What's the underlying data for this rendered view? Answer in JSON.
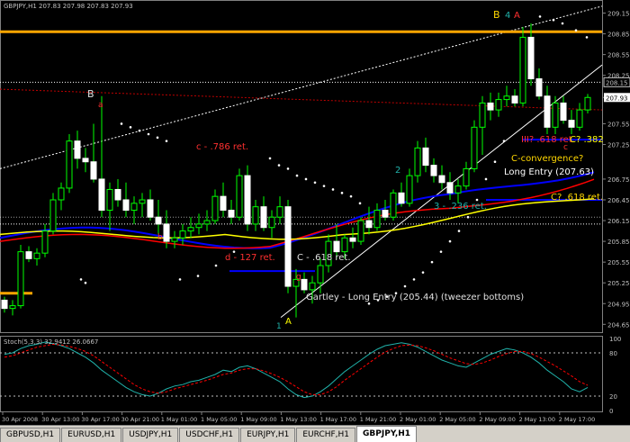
{
  "window": {
    "header": "GBPJPY,H1  207.83 207.98 207.83 207.93",
    "stoch_label": "Stoch(5,3,3) 32.9412 26.0667"
  },
  "colors": {
    "background": "#000000",
    "bull": "#00ff00",
    "bear": "#ffffff",
    "orange": "#ffa500",
    "blue": "#0000ff",
    "red": "#ff0000",
    "yellow": "#ffff00",
    "stoch_main": "#20b2aa",
    "stoch_signal": "#ff0000"
  },
  "price_axis": {
    "ticks": [
      "209.15",
      "208.85",
      "208.55",
      "208.25",
      "207.93",
      "207.55",
      "207.25",
      "206.75",
      "206.45",
      "206.15",
      "205.85",
      "205.55",
      "205.25",
      "204.95",
      "204.65"
    ],
    "current_price": "207.93",
    "mid_label": "208.15",
    "ylim": [
      204.55,
      209.3
    ]
  },
  "stoch_axis": {
    "ticks": [
      "100",
      "80",
      "20",
      "0"
    ],
    "levels": [
      80,
      20
    ]
  },
  "time_axis": {
    "labels": [
      "30 Apr 2008",
      "30 Apr 13:00",
      "30 Apr 17:00",
      "30 Apr 21:00",
      "1 May 01:00",
      "1 May 05:00",
      "1 May 09:00",
      "1 May 13:00",
      "1 May 17:00",
      "1 May 21:00",
      "2 May 01:00",
      "2 May 05:00",
      "2 May 09:00",
      "2 May 13:00",
      "2 May 17:00"
    ]
  },
  "annotations": {
    "B_left": "B",
    "a_left": "a",
    "c_786": "c - .786 ret.",
    "b_label": "b",
    "d_127": "d - 127 ret.",
    "c_618": "C - .618 ret.",
    "gartley": "Gartley - Long Entry (205.44) (tweezer bottoms)",
    "one": "1",
    "A_label": "A",
    "g_label": "g",
    "two": "2",
    "three": "3 - .236 ret.",
    "B_top": "B",
    "four": "4",
    "A_top": "A",
    "III_618": "III? .618 ret.",
    "C_382": "C? .382",
    "C_conv": "C-convergence?",
    "long_entry": "Long Entry (207.63)",
    "C_618_right": "C? .618 ret.",
    "small_c": "c"
  },
  "tabs": [
    "GBPUSD,H1",
    "EURUSD,H1",
    "USDJPY,H1",
    "USDCHF,H1",
    "EURJPY,H1",
    "EURCHF,H1",
    "GBPJPY,H1"
  ],
  "active_tab": "GBPJPY,H1",
  "chart_data": {
    "type": "candlestick",
    "candles": [
      {
        "o": 205.0,
        "h": 205.05,
        "l": 204.82,
        "c": 204.88
      },
      {
        "o": 204.88,
        "h": 205.0,
        "l": 204.78,
        "c": 204.92
      },
      {
        "o": 204.92,
        "h": 205.8,
        "l": 204.88,
        "c": 205.7
      },
      {
        "o": 205.7,
        "h": 205.78,
        "l": 205.55,
        "c": 205.6
      },
      {
        "o": 205.6,
        "h": 205.75,
        "l": 205.5,
        "c": 205.68
      },
      {
        "o": 205.68,
        "h": 206.1,
        "l": 205.62,
        "c": 206.0
      },
      {
        "o": 206.0,
        "h": 206.55,
        "l": 205.95,
        "c": 206.45
      },
      {
        "o": 206.45,
        "h": 206.7,
        "l": 206.3,
        "c": 206.62
      },
      {
        "o": 206.62,
        "h": 207.4,
        "l": 206.55,
        "c": 207.3
      },
      {
        "o": 207.3,
        "h": 207.45,
        "l": 206.9,
        "c": 207.05
      },
      {
        "o": 207.05,
        "h": 207.2,
        "l": 206.85,
        "c": 207.0
      },
      {
        "o": 207.0,
        "h": 207.55,
        "l": 206.7,
        "c": 206.75
      },
      {
        "o": 206.75,
        "h": 207.95,
        "l": 206.2,
        "c": 206.3
      },
      {
        "o": 206.3,
        "h": 206.7,
        "l": 206.0,
        "c": 206.6
      },
      {
        "o": 206.6,
        "h": 206.75,
        "l": 206.35,
        "c": 206.45
      },
      {
        "o": 206.45,
        "h": 206.7,
        "l": 206.2,
        "c": 206.3
      },
      {
        "o": 206.3,
        "h": 206.5,
        "l": 206.1,
        "c": 206.4
      },
      {
        "o": 206.4,
        "h": 206.55,
        "l": 206.2,
        "c": 206.45
      },
      {
        "o": 206.45,
        "h": 206.6,
        "l": 206.15,
        "c": 206.2
      },
      {
        "o": 206.2,
        "h": 206.45,
        "l": 205.95,
        "c": 206.1
      },
      {
        "o": 206.1,
        "h": 206.3,
        "l": 205.75,
        "c": 205.85
      },
      {
        "o": 205.85,
        "h": 206.0,
        "l": 205.75,
        "c": 205.9
      },
      {
        "o": 205.9,
        "h": 206.1,
        "l": 205.8,
        "c": 206.0
      },
      {
        "o": 206.0,
        "h": 206.2,
        "l": 205.9,
        "c": 206.05
      },
      {
        "o": 206.05,
        "h": 206.25,
        "l": 205.95,
        "c": 206.1
      },
      {
        "o": 206.1,
        "h": 206.3,
        "l": 206.0,
        "c": 206.15
      },
      {
        "o": 206.15,
        "h": 206.6,
        "l": 206.1,
        "c": 206.5
      },
      {
        "o": 206.5,
        "h": 206.7,
        "l": 206.2,
        "c": 206.3
      },
      {
        "o": 206.3,
        "h": 206.45,
        "l": 206.1,
        "c": 206.2
      },
      {
        "o": 206.2,
        "h": 206.9,
        "l": 206.15,
        "c": 206.8
      },
      {
        "o": 206.8,
        "h": 206.95,
        "l": 206.0,
        "c": 206.1
      },
      {
        "o": 206.1,
        "h": 206.45,
        "l": 206.0,
        "c": 206.35
      },
      {
        "o": 206.35,
        "h": 206.5,
        "l": 206.0,
        "c": 206.05
      },
      {
        "o": 206.05,
        "h": 206.3,
        "l": 205.9,
        "c": 206.2
      },
      {
        "o": 206.2,
        "h": 206.5,
        "l": 206.1,
        "c": 206.35
      },
      {
        "o": 206.35,
        "h": 206.45,
        "l": 205.1,
        "c": 205.2
      },
      {
        "o": 205.2,
        "h": 205.45,
        "l": 204.75,
        "c": 205.3
      },
      {
        "o": 205.3,
        "h": 205.4,
        "l": 205.1,
        "c": 205.15
      },
      {
        "o": 205.15,
        "h": 205.35,
        "l": 204.95,
        "c": 205.25
      },
      {
        "o": 205.25,
        "h": 205.6,
        "l": 205.1,
        "c": 205.5
      },
      {
        "o": 205.5,
        "h": 205.95,
        "l": 205.4,
        "c": 205.85
      },
      {
        "o": 205.85,
        "h": 206.1,
        "l": 205.6,
        "c": 205.7
      },
      {
        "o": 205.7,
        "h": 205.95,
        "l": 205.6,
        "c": 205.9
      },
      {
        "o": 205.9,
        "h": 206.05,
        "l": 205.75,
        "c": 205.85
      },
      {
        "o": 205.85,
        "h": 206.2,
        "l": 205.8,
        "c": 206.15
      },
      {
        "o": 206.15,
        "h": 206.35,
        "l": 205.95,
        "c": 206.05
      },
      {
        "o": 206.05,
        "h": 206.4,
        "l": 206.0,
        "c": 206.3
      },
      {
        "o": 206.3,
        "h": 206.45,
        "l": 206.15,
        "c": 206.2
      },
      {
        "o": 206.2,
        "h": 206.6,
        "l": 206.15,
        "c": 206.55
      },
      {
        "o": 206.55,
        "h": 206.7,
        "l": 206.35,
        "c": 206.4
      },
      {
        "o": 206.4,
        "h": 206.9,
        "l": 206.35,
        "c": 206.8
      },
      {
        "o": 206.8,
        "h": 207.3,
        "l": 206.7,
        "c": 207.2
      },
      {
        "o": 207.2,
        "h": 207.35,
        "l": 206.85,
        "c": 206.95
      },
      {
        "o": 206.95,
        "h": 207.05,
        "l": 206.7,
        "c": 206.8
      },
      {
        "o": 206.8,
        "h": 206.95,
        "l": 206.6,
        "c": 206.7
      },
      {
        "o": 206.7,
        "h": 206.85,
        "l": 206.45,
        "c": 206.55
      },
      {
        "o": 206.55,
        "h": 206.75,
        "l": 206.4,
        "c": 206.65
      },
      {
        "o": 206.65,
        "h": 207.0,
        "l": 206.6,
        "c": 206.9
      },
      {
        "o": 206.9,
        "h": 207.6,
        "l": 206.85,
        "c": 207.5
      },
      {
        "o": 207.5,
        "h": 207.95,
        "l": 207.1,
        "c": 207.85
      },
      {
        "o": 207.85,
        "h": 208.0,
        "l": 207.6,
        "c": 207.75
      },
      {
        "o": 207.75,
        "h": 208.0,
        "l": 207.65,
        "c": 207.9
      },
      {
        "o": 207.9,
        "h": 208.1,
        "l": 207.8,
        "c": 207.95
      },
      {
        "o": 207.95,
        "h": 208.05,
        "l": 207.8,
        "c": 207.85
      },
      {
        "o": 207.85,
        "h": 208.95,
        "l": 207.8,
        "c": 208.8
      },
      {
        "o": 208.8,
        "h": 209.0,
        "l": 208.1,
        "c": 208.2
      },
      {
        "o": 208.2,
        "h": 208.35,
        "l": 207.9,
        "c": 207.95
      },
      {
        "o": 207.95,
        "h": 208.1,
        "l": 207.4,
        "c": 207.5
      },
      {
        "o": 207.5,
        "h": 207.95,
        "l": 207.4,
        "c": 207.85
      },
      {
        "o": 207.85,
        "h": 207.95,
        "l": 207.55,
        "c": 207.6
      },
      {
        "o": 207.6,
        "h": 207.75,
        "l": 207.4,
        "c": 207.5
      },
      {
        "o": 207.5,
        "h": 207.85,
        "l": 207.45,
        "c": 207.75
      },
      {
        "o": 207.75,
        "h": 207.98,
        "l": 207.7,
        "c": 207.93
      }
    ],
    "stochastic": {
      "main": [
        78,
        80,
        86,
        90,
        92,
        95,
        93,
        90,
        86,
        80,
        74,
        66,
        56,
        48,
        40,
        32,
        26,
        22,
        20,
        24,
        30,
        34,
        36,
        40,
        42,
        46,
        50,
        56,
        54,
        60,
        62,
        58,
        52,
        46,
        40,
        30,
        22,
        18,
        20,
        26,
        34,
        44,
        54,
        62,
        70,
        78,
        85,
        90,
        92,
        94,
        92,
        88,
        82,
        76,
        70,
        66,
        62,
        60,
        66,
        72,
        78,
        82,
        86,
        84,
        80,
        74,
        66,
        56,
        48,
        40,
        30,
        26,
        32
      ],
      "signal": [
        74,
        76,
        80,
        84,
        88,
        90,
        92,
        91,
        89,
        86,
        82,
        76,
        68,
        60,
        52,
        44,
        36,
        30,
        26,
        24,
        26,
        30,
        33,
        36,
        39,
        42,
        46,
        50,
        52,
        56,
        58,
        58,
        55,
        51,
        46,
        40,
        33,
        26,
        22,
        22,
        26,
        33,
        42,
        50,
        58,
        66,
        74,
        81,
        86,
        90,
        91,
        90,
        87,
        83,
        78,
        73,
        69,
        65,
        64,
        66,
        70,
        75,
        79,
        82,
        82,
        79,
        74,
        68,
        62,
        55,
        48,
        40,
        35
      ]
    }
  }
}
